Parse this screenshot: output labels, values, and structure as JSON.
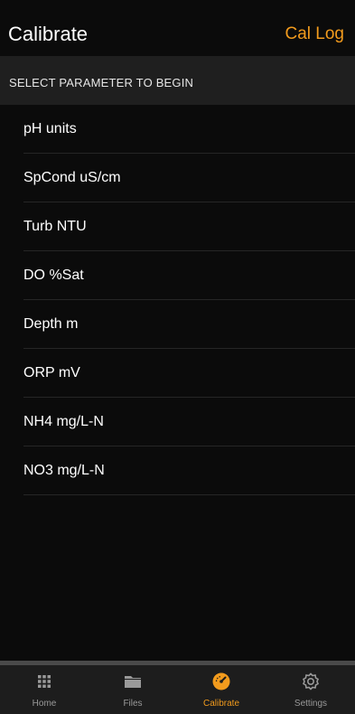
{
  "nav": {
    "title": "Calibrate",
    "action": "Cal Log"
  },
  "section": {
    "header": "SELECT PARAMETER TO BEGIN"
  },
  "parameters": [
    "pH units",
    "SpCond uS/cm",
    "Turb NTU",
    "DO %Sat",
    "Depth m",
    "ORP mV",
    "NH4 mg/L-N",
    "NO3 mg/L-N"
  ],
  "tabs": [
    {
      "label": "Home",
      "icon": "grid-icon",
      "active": false
    },
    {
      "label": "Files",
      "icon": "folder-icon",
      "active": false
    },
    {
      "label": "Calibrate",
      "icon": "gauge-icon",
      "active": true
    },
    {
      "label": "Settings",
      "icon": "gear-icon",
      "active": false
    }
  ],
  "colors": {
    "accent": "#f29b1d",
    "background": "#0b0b0b",
    "section_header_bg": "#1f1f1f",
    "tab_bar_bg": "#1d1d1d",
    "inactive_tab": "#9a9a9a"
  }
}
